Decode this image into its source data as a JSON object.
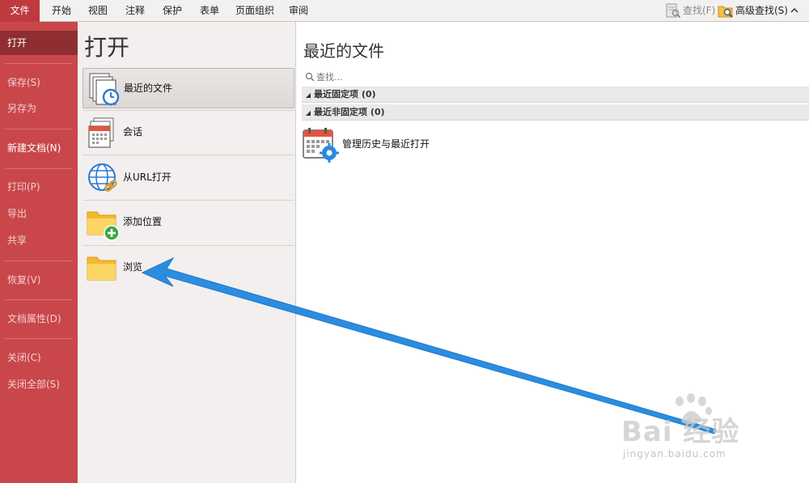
{
  "ribbon": {
    "tabs": [
      "文件",
      "开始",
      "视图",
      "注释",
      "保护",
      "表单",
      "页面组织",
      "审阅"
    ],
    "active_tab": "文件",
    "find_label": "查找(F)",
    "advanced_find_label": "高级查找(S)"
  },
  "nav": {
    "items": [
      "打开",
      "保存(S)",
      "另存为",
      "新建文档(N)",
      "打印(P)",
      "导出",
      "共享",
      "恢复(V)",
      "文档属性(D)",
      "关闭(C)",
      "关闭全部(S)"
    ],
    "active": "打开"
  },
  "open_panel": {
    "title": "打开",
    "options": [
      "最近的文件",
      "会话",
      "从URL打开",
      "添加位置",
      "浏览"
    ],
    "selected": "最近的文件"
  },
  "recent_panel": {
    "title": "最近的文件",
    "search_placeholder": "查找...",
    "groups": [
      "最近固定项 (0)",
      "最近非固定项 (0)"
    ],
    "manage_label": "管理历史与最近打开"
  },
  "watermark": {
    "main": "Bai 经验",
    "sub": "jingyan.baidu.com"
  },
  "colors": {
    "accent": "#c9474b",
    "accent_dark": "#8f2e32",
    "arrow": "#2b8de0"
  }
}
